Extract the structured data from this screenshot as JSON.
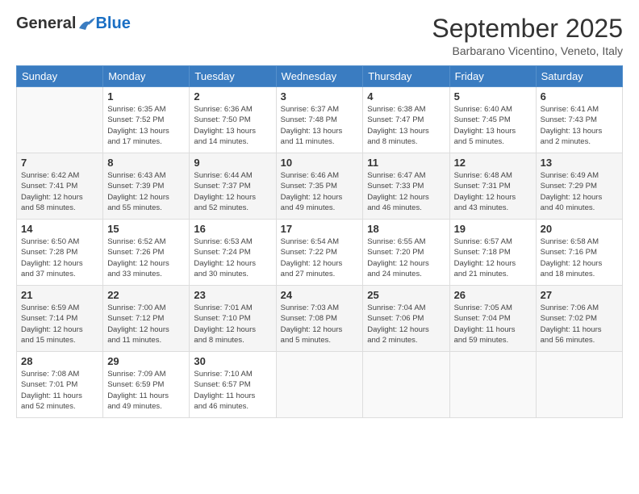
{
  "logo": {
    "general": "General",
    "blue": "Blue"
  },
  "title": "September 2025",
  "location": "Barbarano Vicentino, Veneto, Italy",
  "days_of_week": [
    "Sunday",
    "Monday",
    "Tuesday",
    "Wednesday",
    "Thursday",
    "Friday",
    "Saturday"
  ],
  "weeks": [
    [
      {
        "day": "",
        "info": ""
      },
      {
        "day": "1",
        "info": "Sunrise: 6:35 AM\nSunset: 7:52 PM\nDaylight: 13 hours\nand 17 minutes."
      },
      {
        "day": "2",
        "info": "Sunrise: 6:36 AM\nSunset: 7:50 PM\nDaylight: 13 hours\nand 14 minutes."
      },
      {
        "day": "3",
        "info": "Sunrise: 6:37 AM\nSunset: 7:48 PM\nDaylight: 13 hours\nand 11 minutes."
      },
      {
        "day": "4",
        "info": "Sunrise: 6:38 AM\nSunset: 7:47 PM\nDaylight: 13 hours\nand 8 minutes."
      },
      {
        "day": "5",
        "info": "Sunrise: 6:40 AM\nSunset: 7:45 PM\nDaylight: 13 hours\nand 5 minutes."
      },
      {
        "day": "6",
        "info": "Sunrise: 6:41 AM\nSunset: 7:43 PM\nDaylight: 13 hours\nand 2 minutes."
      }
    ],
    [
      {
        "day": "7",
        "info": "Sunrise: 6:42 AM\nSunset: 7:41 PM\nDaylight: 12 hours\nand 58 minutes."
      },
      {
        "day": "8",
        "info": "Sunrise: 6:43 AM\nSunset: 7:39 PM\nDaylight: 12 hours\nand 55 minutes."
      },
      {
        "day": "9",
        "info": "Sunrise: 6:44 AM\nSunset: 7:37 PM\nDaylight: 12 hours\nand 52 minutes."
      },
      {
        "day": "10",
        "info": "Sunrise: 6:46 AM\nSunset: 7:35 PM\nDaylight: 12 hours\nand 49 minutes."
      },
      {
        "day": "11",
        "info": "Sunrise: 6:47 AM\nSunset: 7:33 PM\nDaylight: 12 hours\nand 46 minutes."
      },
      {
        "day": "12",
        "info": "Sunrise: 6:48 AM\nSunset: 7:31 PM\nDaylight: 12 hours\nand 43 minutes."
      },
      {
        "day": "13",
        "info": "Sunrise: 6:49 AM\nSunset: 7:29 PM\nDaylight: 12 hours\nand 40 minutes."
      }
    ],
    [
      {
        "day": "14",
        "info": "Sunrise: 6:50 AM\nSunset: 7:28 PM\nDaylight: 12 hours\nand 37 minutes."
      },
      {
        "day": "15",
        "info": "Sunrise: 6:52 AM\nSunset: 7:26 PM\nDaylight: 12 hours\nand 33 minutes."
      },
      {
        "day": "16",
        "info": "Sunrise: 6:53 AM\nSunset: 7:24 PM\nDaylight: 12 hours\nand 30 minutes."
      },
      {
        "day": "17",
        "info": "Sunrise: 6:54 AM\nSunset: 7:22 PM\nDaylight: 12 hours\nand 27 minutes."
      },
      {
        "day": "18",
        "info": "Sunrise: 6:55 AM\nSunset: 7:20 PM\nDaylight: 12 hours\nand 24 minutes."
      },
      {
        "day": "19",
        "info": "Sunrise: 6:57 AM\nSunset: 7:18 PM\nDaylight: 12 hours\nand 21 minutes."
      },
      {
        "day": "20",
        "info": "Sunrise: 6:58 AM\nSunset: 7:16 PM\nDaylight: 12 hours\nand 18 minutes."
      }
    ],
    [
      {
        "day": "21",
        "info": "Sunrise: 6:59 AM\nSunset: 7:14 PM\nDaylight: 12 hours\nand 15 minutes."
      },
      {
        "day": "22",
        "info": "Sunrise: 7:00 AM\nSunset: 7:12 PM\nDaylight: 12 hours\nand 11 minutes."
      },
      {
        "day": "23",
        "info": "Sunrise: 7:01 AM\nSunset: 7:10 PM\nDaylight: 12 hours\nand 8 minutes."
      },
      {
        "day": "24",
        "info": "Sunrise: 7:03 AM\nSunset: 7:08 PM\nDaylight: 12 hours\nand 5 minutes."
      },
      {
        "day": "25",
        "info": "Sunrise: 7:04 AM\nSunset: 7:06 PM\nDaylight: 12 hours\nand 2 minutes."
      },
      {
        "day": "26",
        "info": "Sunrise: 7:05 AM\nSunset: 7:04 PM\nDaylight: 11 hours\nand 59 minutes."
      },
      {
        "day": "27",
        "info": "Sunrise: 7:06 AM\nSunset: 7:02 PM\nDaylight: 11 hours\nand 56 minutes."
      }
    ],
    [
      {
        "day": "28",
        "info": "Sunrise: 7:08 AM\nSunset: 7:01 PM\nDaylight: 11 hours\nand 52 minutes."
      },
      {
        "day": "29",
        "info": "Sunrise: 7:09 AM\nSunset: 6:59 PM\nDaylight: 11 hours\nand 49 minutes."
      },
      {
        "day": "30",
        "info": "Sunrise: 7:10 AM\nSunset: 6:57 PM\nDaylight: 11 hours\nand 46 minutes."
      },
      {
        "day": "",
        "info": ""
      },
      {
        "day": "",
        "info": ""
      },
      {
        "day": "",
        "info": ""
      },
      {
        "day": "",
        "info": ""
      }
    ]
  ]
}
